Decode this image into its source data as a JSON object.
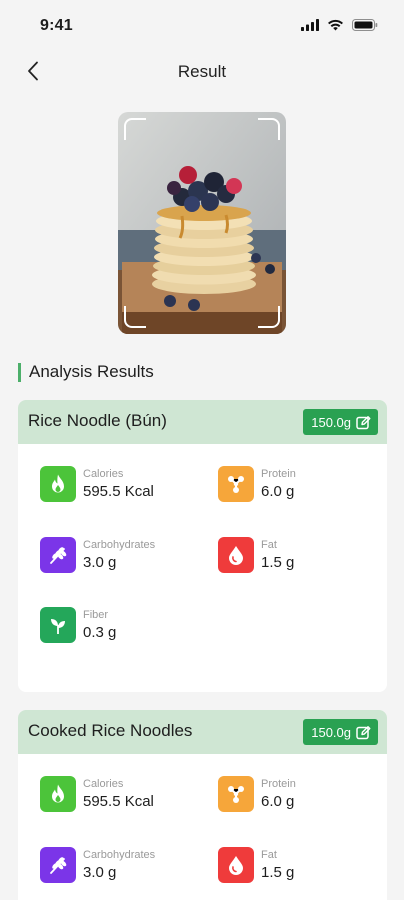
{
  "status_bar": {
    "time": "9:41"
  },
  "nav": {
    "title": "Result"
  },
  "section": {
    "heading": "Analysis Results"
  },
  "cards": [
    {
      "title": "Rice Noodle (Bún)",
      "weight": "150.0g",
      "nutrients": {
        "calories": {
          "label": "Calories",
          "value": "595.5 Kcal"
        },
        "protein": {
          "label": "Protein",
          "value": "6.0 g"
        },
        "carbs": {
          "label": "Carbohydrates",
          "value": "3.0 g"
        },
        "fat": {
          "label": "Fat",
          "value": "1.5 g"
        },
        "fiber": {
          "label": "Fiber",
          "value": "0.3 g"
        }
      }
    },
    {
      "title": "Cooked Rice Noodles",
      "weight": "150.0g",
      "nutrients": {
        "calories": {
          "label": "Calories",
          "value": "595.5 Kcal"
        },
        "protein": {
          "label": "Protein",
          "value": "6.0 g"
        },
        "carbs": {
          "label": "Carbohydrates",
          "value": "3.0 g"
        },
        "fat": {
          "label": "Fat",
          "value": "1.5 g"
        }
      }
    }
  ],
  "colors": {
    "accent": "#2aa152",
    "card_header": "#cfe6d3",
    "calories_icon": "#4cc43a",
    "protein_icon": "#f6a63a",
    "carbs_icon": "#7b35e8",
    "fat_icon": "#ef3b3b",
    "fiber_icon": "#24a75a"
  },
  "icons": {
    "calories": "flame-icon",
    "protein": "molecule-icon",
    "carbs": "wheat-icon",
    "fat": "drop-icon",
    "fiber": "leaf-icon",
    "edit": "edit-icon"
  }
}
